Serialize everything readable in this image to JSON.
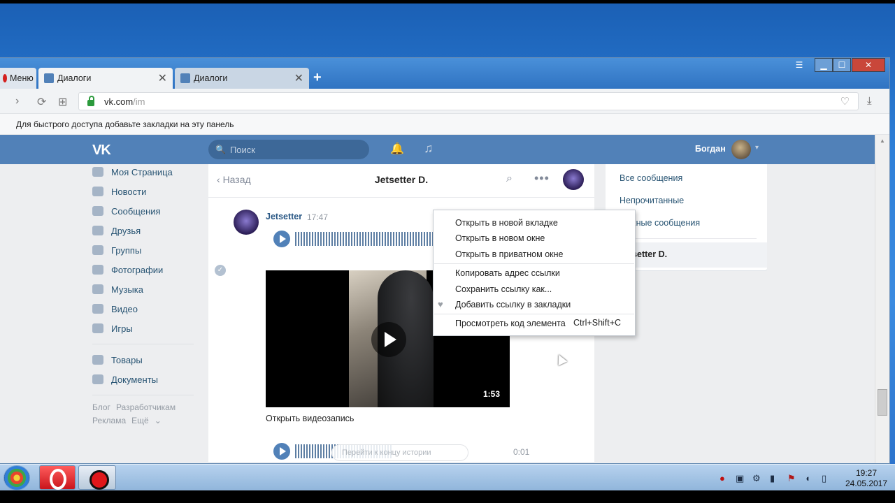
{
  "browser": {
    "menu_label": "Меню",
    "tabs": [
      {
        "title": "Диалоги",
        "active": true
      },
      {
        "title": "Диалоги",
        "active": false
      }
    ],
    "new_tab": "+",
    "url_host": "vk.com",
    "url_path": "/im",
    "bookmarks_hint": "Для быстрого доступа добавьте закладки на эту панель"
  },
  "vk": {
    "logo": "VK",
    "search_placeholder": "Поиск",
    "user_name": "Богдан",
    "left_menu": [
      "Моя Страница",
      "Новости",
      "Сообщения",
      "Друзья",
      "Группы",
      "Фотографии",
      "Музыка",
      "Видео",
      "Игры"
    ],
    "left_menu_2": [
      "Товары",
      "Документы"
    ],
    "footer": [
      "Блог",
      "Разработчикам",
      "Реклама",
      "Ещё"
    ],
    "chat": {
      "back": "Назад",
      "title": "Jetsetter D.",
      "message": {
        "author": "Jetsetter",
        "time": "17:47",
        "video_duration": "1:53",
        "video_link": "Открыть видеозапись",
        "audio2_duration": "0:01",
        "input_hint": "Перейти к концу истории"
      }
    },
    "right_panel": {
      "all_messages": "Все сообщения",
      "unread": "Непрочитанные",
      "important": "Важные сообщения",
      "active_dialog": "Jetsetter D."
    }
  },
  "context_menu": {
    "items": [
      "Открыть в новой вкладке",
      "Открыть в новом окне",
      "Открыть в приватном окне",
      "Копировать адрес ссылки",
      "Сохранить ссылку как...",
      "Добавить ссылку в закладки",
      "Просмотреть код элемента"
    ],
    "inspect_shortcut": "Ctrl+Shift+C"
  },
  "taskbar": {
    "time": "19:27",
    "date": "24.05.2017"
  },
  "colors": {
    "vk_blue": "#5181b8",
    "link": "#285473",
    "page_bg": "#edeef0"
  }
}
